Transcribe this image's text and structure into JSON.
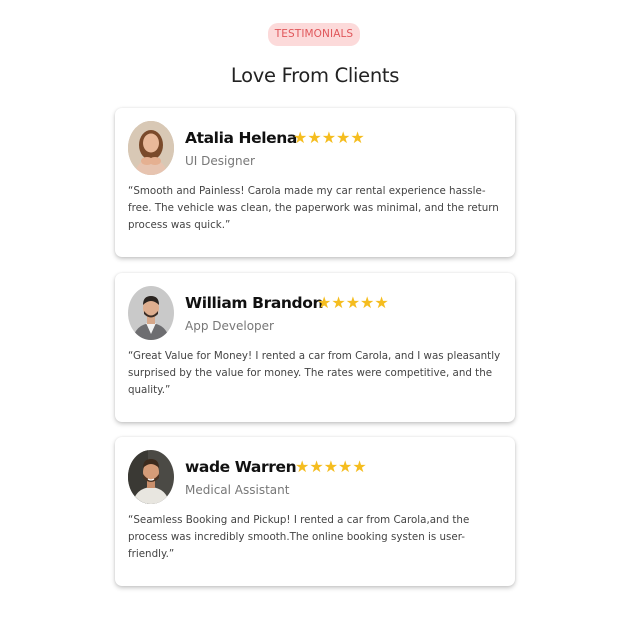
{
  "badge": "TESTIMONIALS",
  "heading": "Love From Clients",
  "testimonials": [
    {
      "name": "Atalia Helena",
      "stars": "★★★★★",
      "role": "UI Designer",
      "quote": "“Smooth and Painless! Carola made my car rental experience hassle-free. The vehicle was clean, the paperwork was minimal, and the return process was quick.”"
    },
    {
      "name": "William Brandon",
      "stars": "★★★★★",
      "role": "App Developer",
      "quote": "“Great Value for Money! I rented a car from Carola, and I was pleasantly surprised by the value for money. The rates were competitive, and the quality.”"
    },
    {
      "name": "wade Warren",
      "stars": "★★★★★",
      "role": "Medical Assistant",
      "quote": "“Seamless Booking and Pickup! I rented a car from Carola,and the process was incredibly smooth.The online booking systen is user-friendly.”"
    }
  ],
  "colors": {
    "badge_bg": "#fcdada",
    "badge_text": "#e0565a",
    "star": "#f5bd1f"
  }
}
